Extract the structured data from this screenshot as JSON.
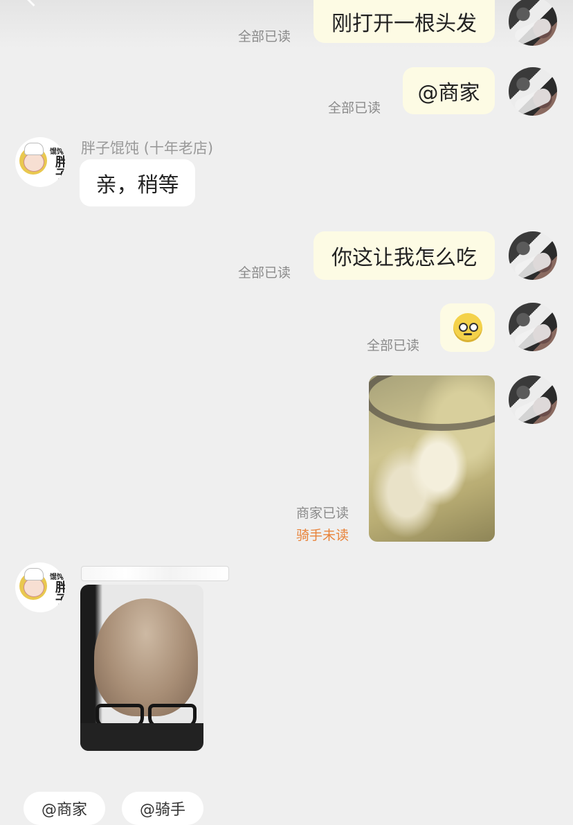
{
  "shop": {
    "name": "胖子馄饨 (十年老店)",
    "logo_chars": [
      "馄饨",
      "胖子"
    ]
  },
  "messages": [
    {
      "text": "刚打开一根头发",
      "status": "全部已读"
    },
    {
      "text": "@商家",
      "status": "全部已读"
    },
    {
      "text": "亲，稍等"
    },
    {
      "text": "你这让我怎么吃",
      "status": "全部已读"
    },
    {
      "emoji": "pleading-face-icon",
      "status": "全部已读"
    },
    {
      "image": "soup-photo",
      "status_merchant": "商家已读",
      "status_rider": "骑手未读"
    },
    {
      "image": "bald-head-photo"
    }
  ],
  "quick_actions": [
    "@商家",
    "@骑手"
  ],
  "colors": {
    "my_bubble": "#fdfbe4",
    "their_bubble": "#ffffff",
    "unread": "#e8833a",
    "background": "#efefef"
  }
}
